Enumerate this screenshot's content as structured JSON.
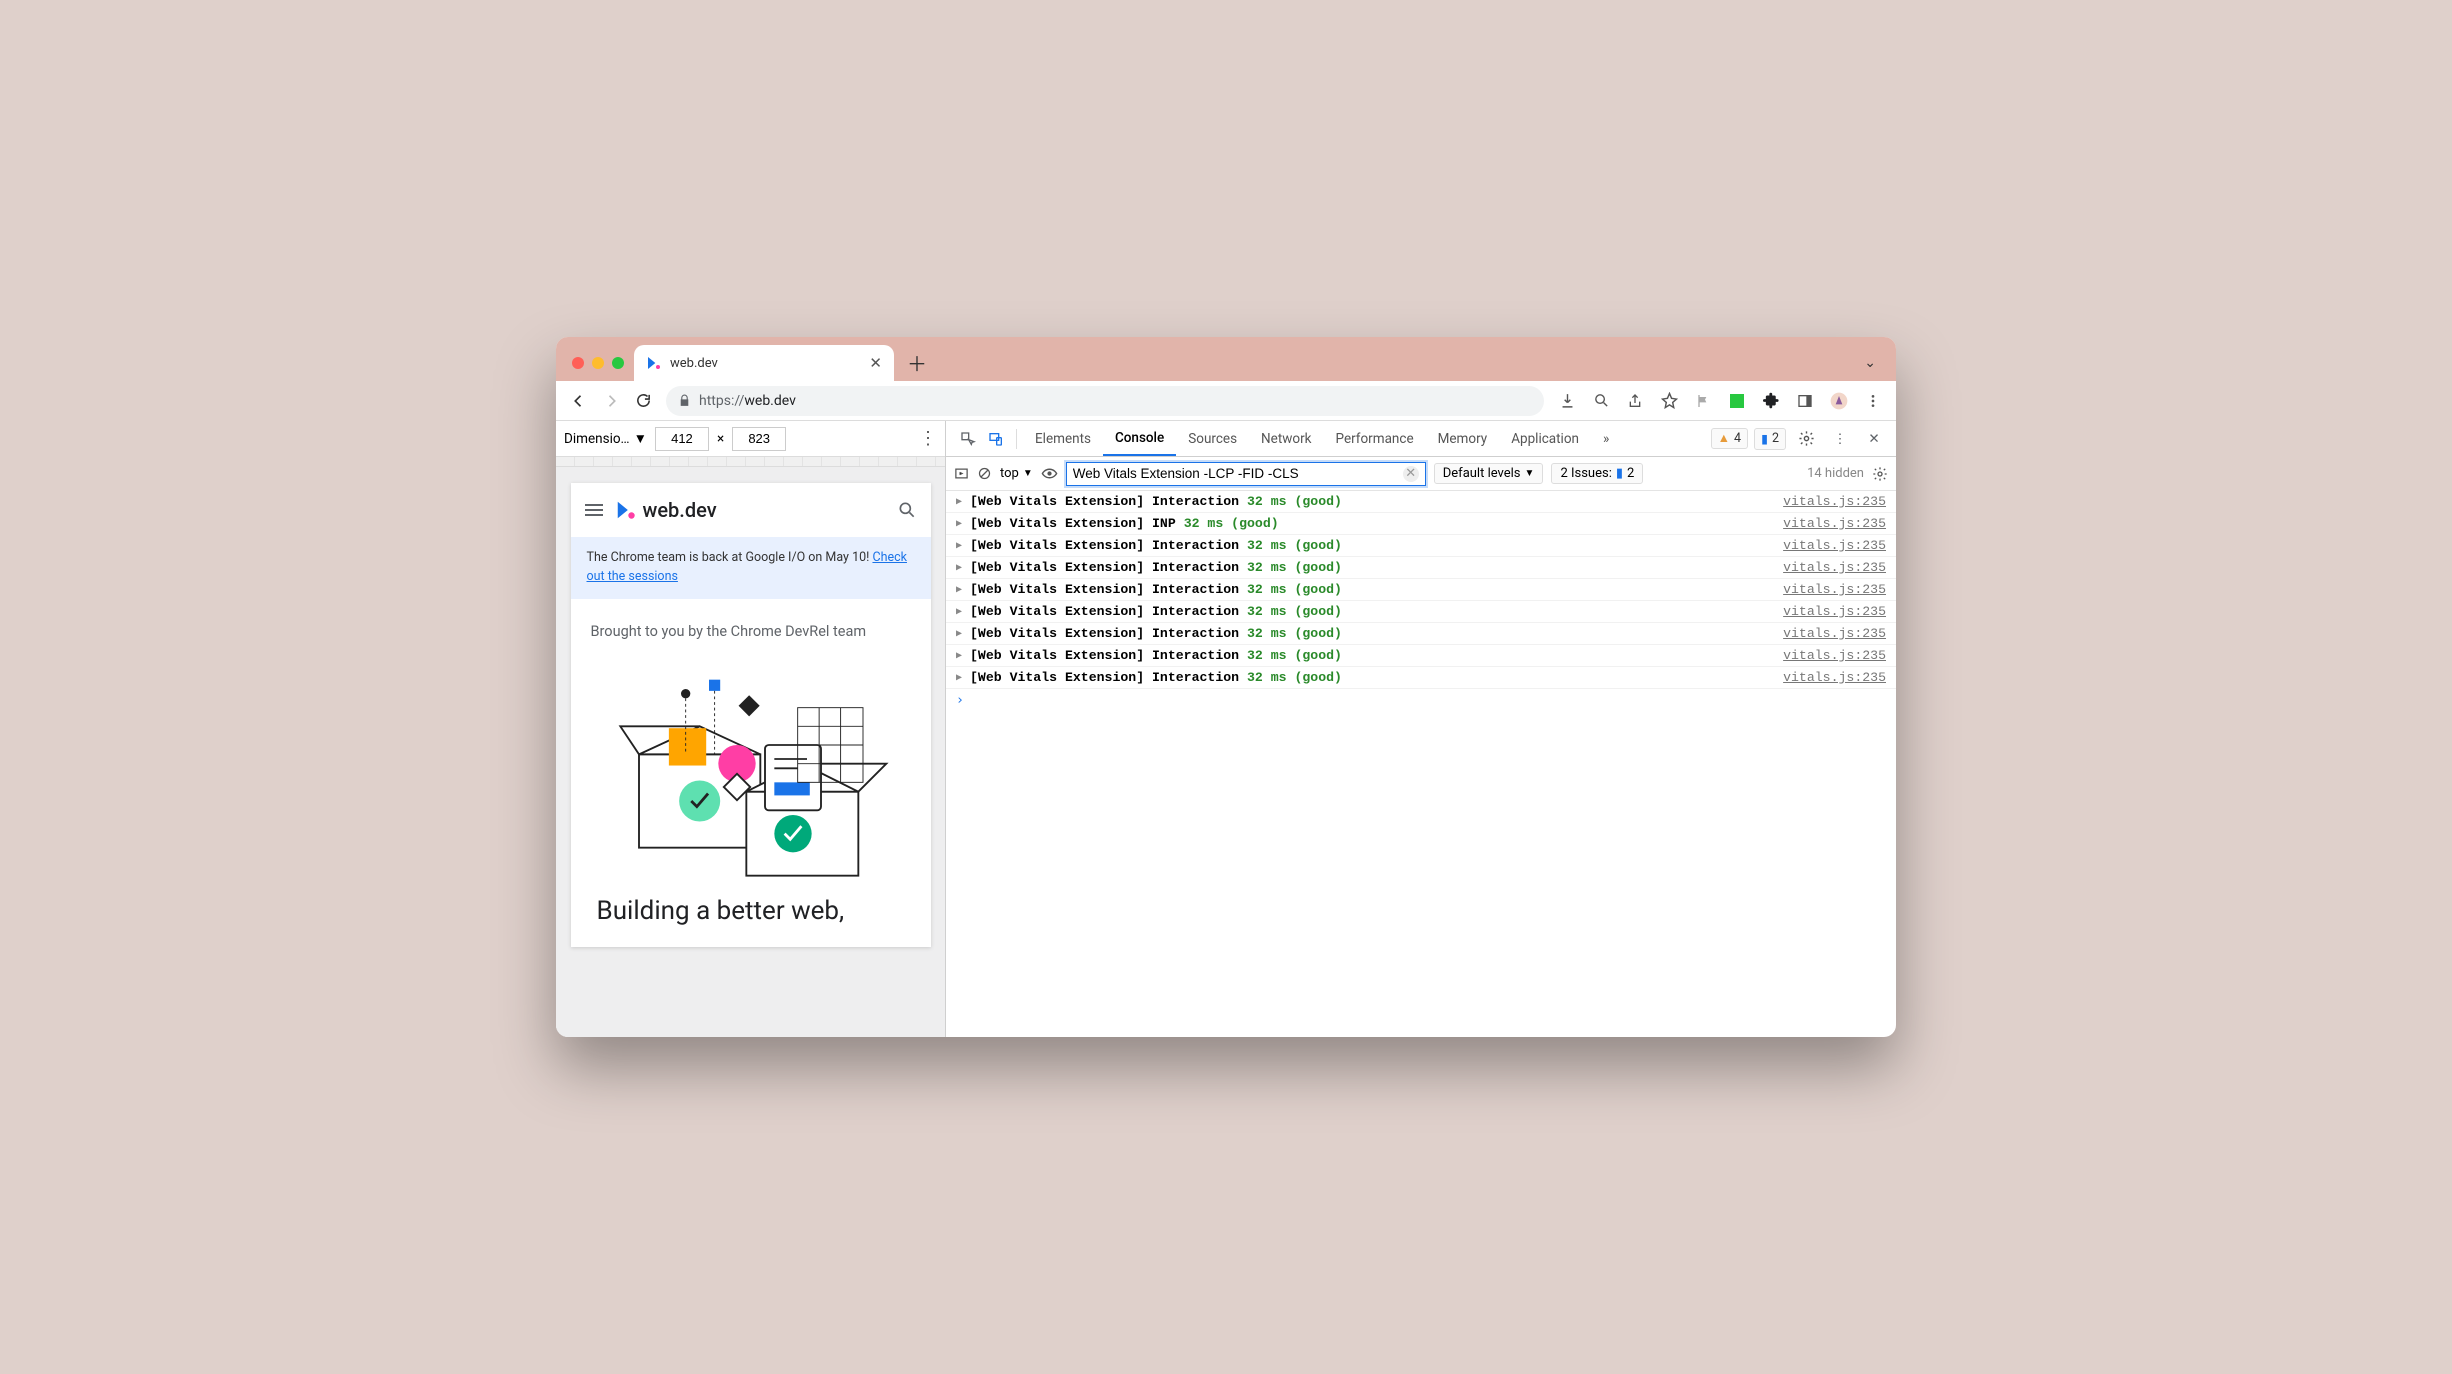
{
  "browser": {
    "tab_title": "web.dev",
    "url": "https://web.dev",
    "url_prefix": "https://",
    "url_host": "web.dev"
  },
  "device_mode": {
    "dimensions_label": "Dimensio…",
    "width": "412",
    "height": "823",
    "separator": "×"
  },
  "webpage": {
    "site_name": "web.dev",
    "banner_text": "The Chrome team is back at Google I/O on May 10! ",
    "banner_link": "Check out the sessions",
    "brought": "Brought to you by the Chrome DevRel team",
    "headline": "Building a better web,"
  },
  "devtools": {
    "tabs": [
      "Elements",
      "Console",
      "Sources",
      "Network",
      "Performance",
      "Memory",
      "Application"
    ],
    "active_tab": "Console",
    "more_tabs_glyph": "»",
    "warning_count": "4",
    "message_count": "2",
    "console": {
      "context": "top",
      "filter_value": "Web Vitals Extension -LCP -FID -CLS",
      "levels": "Default levels",
      "issues_label": "2 Issues:",
      "issues_count": "2",
      "hidden_label": "14 hidden"
    },
    "logs": [
      {
        "label": "[Web Vitals Extension] Interaction",
        "metric": "32 ms (good)",
        "source": "vitals.js:235"
      },
      {
        "label": "[Web Vitals Extension] INP",
        "metric": "32 ms (good)",
        "source": "vitals.js:235"
      },
      {
        "label": "[Web Vitals Extension] Interaction",
        "metric": "32 ms (good)",
        "source": "vitals.js:235"
      },
      {
        "label": "[Web Vitals Extension] Interaction",
        "metric": "32 ms (good)",
        "source": "vitals.js:235"
      },
      {
        "label": "[Web Vitals Extension] Interaction",
        "metric": "32 ms (good)",
        "source": "vitals.js:235"
      },
      {
        "label": "[Web Vitals Extension] Interaction",
        "metric": "32 ms (good)",
        "source": "vitals.js:235"
      },
      {
        "label": "[Web Vitals Extension] Interaction",
        "metric": "32 ms (good)",
        "source": "vitals.js:235"
      },
      {
        "label": "[Web Vitals Extension] Interaction",
        "metric": "32 ms (good)",
        "source": "vitals.js:235"
      },
      {
        "label": "[Web Vitals Extension] Interaction",
        "metric": "32 ms (good)",
        "source": "vitals.js:235"
      }
    ]
  }
}
